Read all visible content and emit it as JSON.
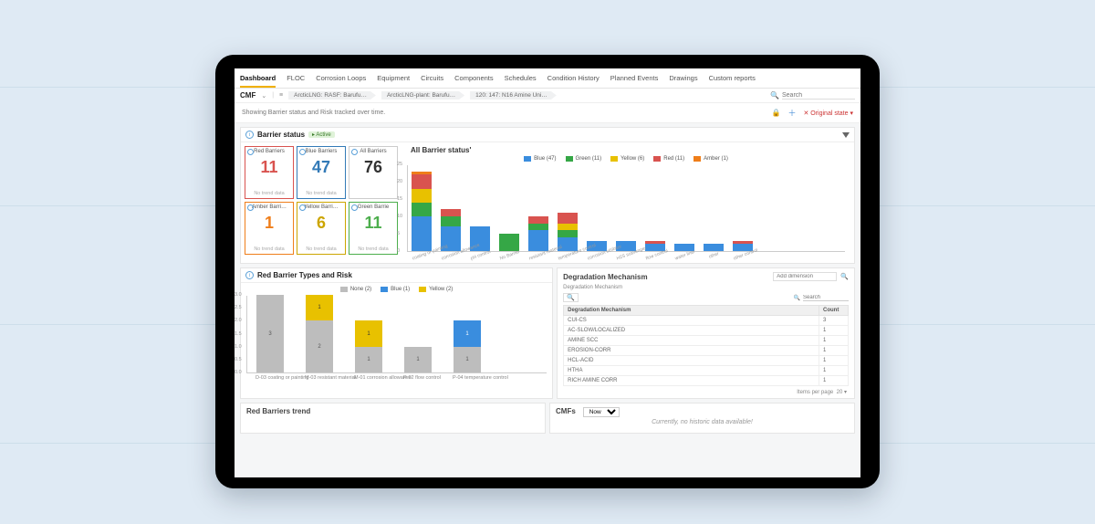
{
  "nav": {
    "tabs": [
      "Dashboard",
      "FLOC",
      "Corrosion Loops",
      "Equipment",
      "Circuits",
      "Components",
      "Schedules",
      "Condition History",
      "Planned Events",
      "Drawings",
      "Custom reports"
    ],
    "active": 0
  },
  "crumbs": {
    "cmf": "CMF",
    "items": [
      "ArcticLNG: RASF: Barufu…",
      "ArcticLNG-plant: Barufu…",
      "120: 147: N16 Amine Uni…"
    ]
  },
  "search_placeholder": "Search",
  "description": "Showing Barrier status and Risk tracked over time.",
  "toolbar": {
    "original_state": "Original state"
  },
  "barrier_status": {
    "title": "Barrier status",
    "badge": "Active",
    "cards": [
      {
        "title": "Red Barriers",
        "value": 11,
        "footer": "No trend data",
        "cls": "red"
      },
      {
        "title": "Blue Barriers",
        "value": 47,
        "footer": "No trend data",
        "cls": "blue"
      },
      {
        "title": "All Barriers",
        "value": 76,
        "footer": "",
        "cls": "all"
      },
      {
        "title": "Amber Barri…",
        "value": 1,
        "footer": "No trend data",
        "cls": "amber"
      },
      {
        "title": "Yellow Barri…",
        "value": 6,
        "footer": "No trend data",
        "cls": "yellow"
      },
      {
        "title": "Green Barrie",
        "value": 11,
        "footer": "No trend data",
        "cls": "green"
      }
    ]
  },
  "chart_data": [
    {
      "id": "all_barrier_status",
      "type": "bar",
      "stacked": true,
      "title": "All Barrier status'",
      "yticks": [
        0,
        5,
        10,
        15,
        20,
        25
      ],
      "ylim": [
        0,
        25
      ],
      "legend": [
        {
          "name": "Blue",
          "count": 47,
          "color": "#3a8dde"
        },
        {
          "name": "Green",
          "count": 11,
          "color": "#35a746"
        },
        {
          "name": "Yellow",
          "count": 6,
          "color": "#e8c100"
        },
        {
          "name": "Red",
          "count": 11,
          "color": "#d9534f"
        },
        {
          "name": "Amber",
          "count": 1,
          "color": "#ef7e1a"
        }
      ],
      "categories": [
        "coating or painting",
        "corrosion allowance",
        "pH control",
        "No Barrier",
        "resistant material",
        "temperature control",
        "corrosion inhibitor",
        "H2S scavenger",
        "flow control",
        "water liner",
        "other",
        "other control"
      ],
      "series": [
        {
          "name": "Blue",
          "values": [
            10,
            7,
            7,
            0,
            6,
            4,
            3,
            3,
            2,
            2,
            2,
            2
          ]
        },
        {
          "name": "Green",
          "values": [
            4,
            3,
            0,
            5,
            2,
            2,
            0,
            0,
            0,
            0,
            0,
            0
          ]
        },
        {
          "name": "Yellow",
          "values": [
            4,
            0,
            0,
            0,
            0,
            2,
            0,
            0,
            0,
            0,
            0,
            0
          ]
        },
        {
          "name": "Red",
          "values": [
            4,
            2,
            0,
            0,
            2,
            3,
            0,
            0,
            1,
            0,
            0,
            1
          ]
        },
        {
          "name": "Amber",
          "values": [
            1,
            0,
            0,
            0,
            0,
            0,
            0,
            0,
            0,
            0,
            0,
            0
          ]
        }
      ]
    },
    {
      "id": "red_barrier_types",
      "type": "bar",
      "stacked": true,
      "title": "Red Barrier Types and Risk",
      "ylim": [
        0,
        3
      ],
      "yticks": [
        0,
        0.5,
        1.0,
        1.5,
        2.0,
        2.5,
        3.0
      ],
      "legend": [
        {
          "name": "None",
          "count": 2,
          "color": "#bdbdbd"
        },
        {
          "name": "Blue",
          "count": 1,
          "color": "#3a8dde"
        },
        {
          "name": "Yellow",
          "count": 2,
          "color": "#e8c100"
        }
      ],
      "categories": [
        "D-03  coating or painting",
        "M-03  resistant material",
        "M-01  corrosion allowance",
        "P-02  flow control",
        "P-04  temperature control"
      ],
      "series": [
        {
          "name": "None",
          "values": [
            3,
            2,
            1,
            1,
            1
          ]
        },
        {
          "name": "Yellow",
          "values": [
            0,
            1,
            1,
            0,
            0
          ]
        },
        {
          "name": "Blue",
          "values": [
            0,
            0,
            0,
            0,
            1
          ]
        }
      ]
    }
  ],
  "degradation": {
    "title": "Degradation Mechanism",
    "subtitle": "Degradation Mechanism",
    "add_dimension": "Add dimension",
    "search_placeholder": "Search",
    "columns": [
      "Degradation Mechanism",
      "Count"
    ],
    "rows": [
      {
        "name": "CUI-CS",
        "count": 3
      },
      {
        "name": "AC-SLOW/LOCALIZED",
        "count": 1
      },
      {
        "name": "AMINE SCC",
        "count": 1
      },
      {
        "name": "EROSION-CORR",
        "count": 1
      },
      {
        "name": "HCL-ACID",
        "count": 1
      },
      {
        "name": "HTHA",
        "count": 1
      },
      {
        "name": "RICH AMINE CORR",
        "count": 1
      }
    ],
    "pager_label": "Items per page",
    "pager_value": 20
  },
  "trend_panel": {
    "title": "Red Barriers trend"
  },
  "cmfs_panel": {
    "title": "CMFs",
    "select_value": "Now",
    "no_data": "Currently, no historic data available!"
  }
}
